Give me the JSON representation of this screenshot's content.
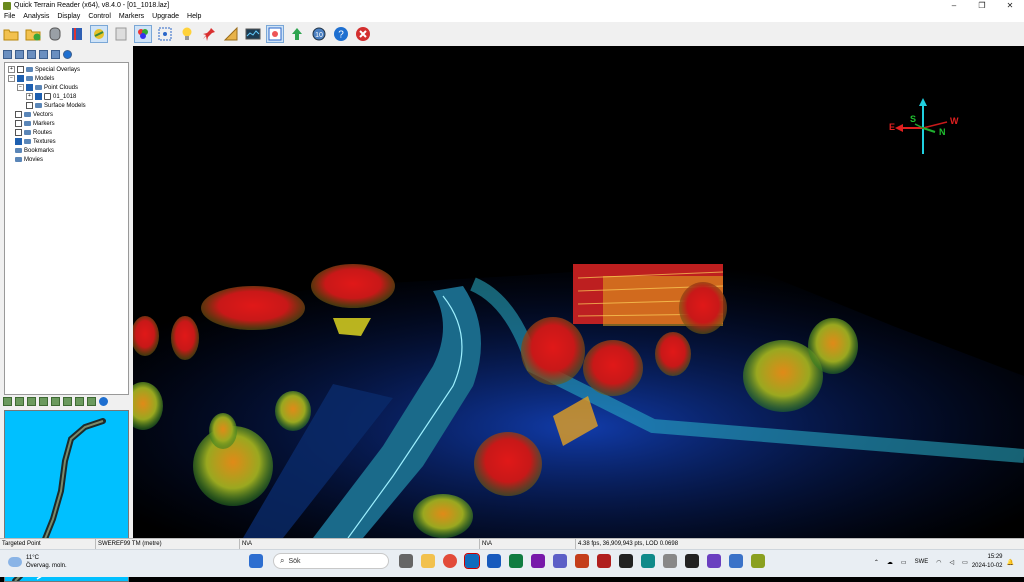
{
  "window": {
    "title": "Quick Terrain Reader (x64), v8.4.0 - [01_1018.laz]",
    "controls": [
      "–",
      "❐",
      "✕"
    ]
  },
  "menu": [
    "File",
    "Analysis",
    "Display",
    "Control",
    "Markers",
    "Upgrade",
    "Help"
  ],
  "toolbar_icons": [
    "open-folder-icon",
    "add-icon",
    "cylinder-icon",
    "book-icon",
    "layers-icon",
    "clipboard-icon",
    "color-palette-icon",
    "select-icon",
    "lightbulb-icon",
    "pin-icon",
    "ruler-icon",
    "graph-icon",
    "image-icon",
    "arrow-icon",
    "counter-10-icon",
    "help-icon",
    "close-icon"
  ],
  "toolbar_extra": {
    "counter": "10"
  },
  "tree": {
    "special_overlays": "Special Overlays",
    "models": "Models",
    "point_clouds": "Point Clouds",
    "cloud_item": "01_1018",
    "surface_models": "Surface Models",
    "vectors": "Vectors",
    "markers": "Markers",
    "routes": "Routes",
    "textures": "Textures",
    "bookmarks": "Bookmarks",
    "movies": "Movies"
  },
  "compass": {
    "north": "N",
    "south": "S",
    "east": "E",
    "west": "W"
  },
  "status": {
    "mode": "Targeted Point",
    "crs": "SWEREF99 TM (metre)",
    "field1": "N\\A",
    "field2": "N\\A",
    "perf": "4.38 fps, 36,909,943 pts, LOD 0.0698"
  },
  "taskbar": {
    "temperature": "11°C",
    "weather": "Övervag. moln.",
    "search_placeholder": "Sök",
    "language": "SWE",
    "time": "15:29",
    "date": "2024-10-02"
  },
  "colors": {
    "accent": "#1d5fb0",
    "minimap_bg": "#00c0ff",
    "scan_red": "#d22020",
    "scan_blue": "#1040c8",
    "scan_cyan": "#30c8d8"
  }
}
